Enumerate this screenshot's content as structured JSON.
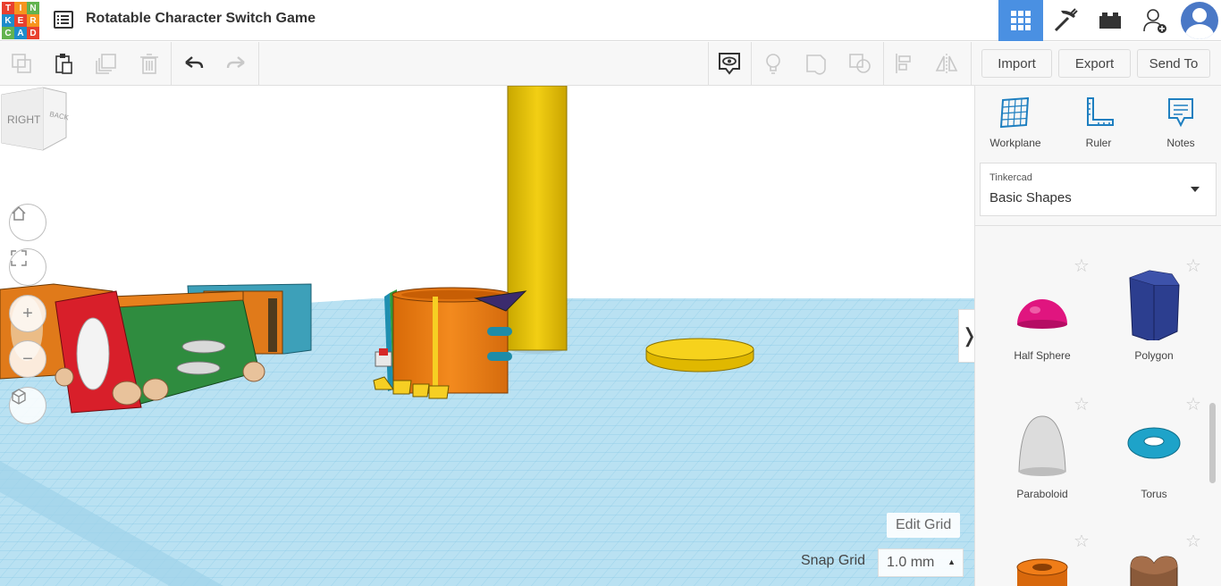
{
  "app": {
    "logo_letters": [
      "T",
      "I",
      "N",
      "K",
      "E",
      "R",
      "C",
      "A",
      "D"
    ],
    "title": "Rotatable Character Switch Game"
  },
  "topbar_icons": [
    "grid-view-icon",
    "pickaxe-icon",
    "brick-icon",
    "add-user-icon",
    "avatar"
  ],
  "toolbar": {
    "import_label": "Import",
    "export_label": "Export",
    "send_to_label": "Send To"
  },
  "viewcube": {
    "face_right": "RIGHT",
    "face_back": "BACK"
  },
  "viewport": {
    "edit_grid_label": "Edit Grid",
    "snap_grid_label": "Snap Grid",
    "snap_grid_value": "1.0 mm"
  },
  "panel": {
    "tools": [
      {
        "label": "Workplane"
      },
      {
        "label": "Ruler"
      },
      {
        "label": "Notes"
      }
    ],
    "library_category": "Tinkercad",
    "library_name": "Basic Shapes",
    "shapes": [
      {
        "name": "Half Sphere",
        "color": "#e0157f"
      },
      {
        "name": "Polygon",
        "color": "#2c3e8f"
      },
      {
        "name": "Paraboloid",
        "color": "#d9d9d9"
      },
      {
        "name": "Torus",
        "color": "#1ea3c9"
      }
    ]
  },
  "colors": {
    "accent": "#4a90e2",
    "grid_blue": "#a7d9ee"
  }
}
